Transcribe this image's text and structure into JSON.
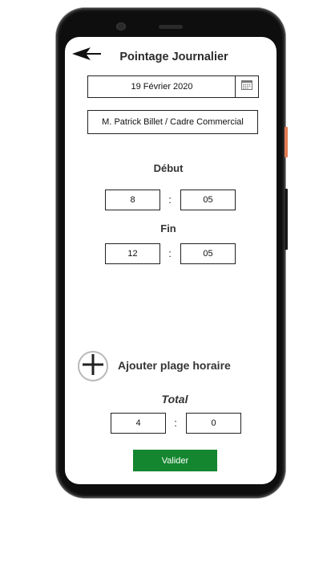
{
  "header": {
    "title": "Pointage Journalier"
  },
  "date": {
    "value": "19 Février 2020"
  },
  "person": {
    "value": "M. Patrick Billet / Cadre Commercial"
  },
  "debut": {
    "label": "Début",
    "hours": "8",
    "minutes": "05",
    "separator": ":"
  },
  "fin": {
    "label": "Fin",
    "hours": "12",
    "minutes": "05",
    "separator": ":"
  },
  "add_range": {
    "label": "Ajouter plage horaire"
  },
  "total": {
    "label": "Total",
    "hours": "4",
    "minutes": "0",
    "separator": ":"
  },
  "submit": {
    "label": "Valider"
  },
  "colors": {
    "accent": "#14862f",
    "side_button": "#e07a55"
  },
  "icons": {
    "back": "back-arrow-icon",
    "calendar": "calendar-icon",
    "add": "plus-icon"
  }
}
